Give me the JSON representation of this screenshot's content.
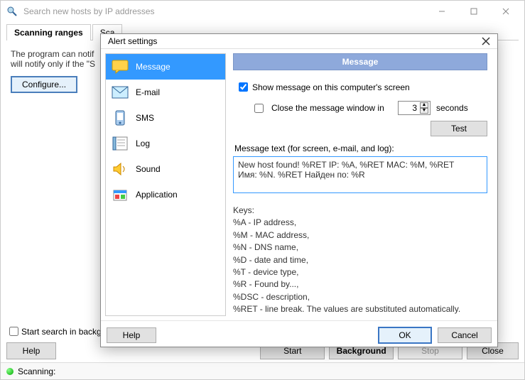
{
  "window": {
    "title": "Search new hosts by IP addresses"
  },
  "tabs": [
    "Scanning ranges",
    "Sca"
  ],
  "main": {
    "desc_line1": "The program can notif",
    "desc_line2": "will notify only if the \"S",
    "configure_label": "Configure..."
  },
  "bottom": {
    "start_bg_label": "Start search in backgro",
    "help_label": "Help",
    "start_label": "Start",
    "background_label": "Background",
    "stop_label": "Stop",
    "close_label": "Close"
  },
  "status": {
    "text": "Scanning:"
  },
  "dialog": {
    "title": "Alert settings",
    "sidebar": {
      "items": [
        {
          "label": "Message",
          "icon": "message"
        },
        {
          "label": "E-mail",
          "icon": "email"
        },
        {
          "label": "SMS",
          "icon": "sms"
        },
        {
          "label": "Log",
          "icon": "log"
        },
        {
          "label": "Sound",
          "icon": "sound"
        },
        {
          "label": "Application",
          "icon": "app"
        }
      ],
      "selected": 0
    },
    "panel": {
      "header": "Message",
      "show_checkbox": {
        "checked": true,
        "label": "Show message on this computer's screen"
      },
      "close_checkbox": {
        "checked": false,
        "label": "Close the message window in"
      },
      "close_value": "3",
      "close_unit": "seconds",
      "test_label": "Test",
      "msg_label": "Message text (for screen, e-mail, and log):",
      "msg_text": "New host found! %RET IP: %A, %RET MAC: %M, %RET\nИмя: %N. %RET Найден по: %R",
      "keys_title": "Keys:",
      "keys": [
        "%A - IP address,",
        "%M - MAC address,",
        "%N - DNS name,",
        "%D - date and time,",
        "%T - device type,",
        "%R - Found by...,",
        "%DSC - description,",
        "%RET - line break. The values are substituted automatically."
      ]
    },
    "buttons": {
      "help": "Help",
      "ok": "OK",
      "cancel": "Cancel"
    }
  }
}
